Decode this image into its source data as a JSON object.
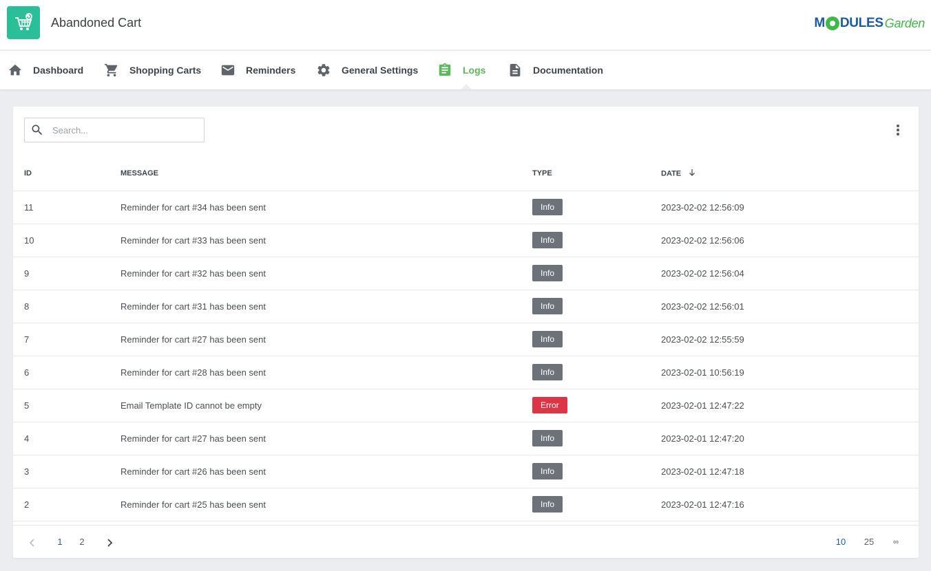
{
  "app": {
    "title": "Abandoned Cart",
    "icon": "shopping-cart-refresh-icon",
    "accent": "#2bbf99"
  },
  "brand": {
    "part1": "M",
    "part2": "DULES",
    "part3": "Garden",
    "colors": {
      "blue": "#1b5aa6",
      "green": "#41b94a"
    }
  },
  "nav": {
    "active_color": "#5cb85c",
    "items": [
      {
        "label": "Dashboard",
        "icon": "home-icon"
      },
      {
        "label": "Shopping Carts",
        "icon": "cart-icon"
      },
      {
        "label": "Reminders",
        "icon": "envelope-icon"
      },
      {
        "label": "General Settings",
        "icon": "gear-icon"
      },
      {
        "label": "Logs",
        "icon": "clipboard-icon",
        "active": true
      },
      {
        "label": "Documentation",
        "icon": "document-icon"
      }
    ]
  },
  "search": {
    "placeholder": "Search...",
    "value": ""
  },
  "table": {
    "columns": {
      "id": "ID",
      "message": "MESSAGE",
      "type": "TYPE",
      "date": "DATE"
    },
    "sorted_by": "date-desc",
    "rows": [
      {
        "id": "11",
        "message": "Reminder for cart #34 has been sent",
        "type": "Info",
        "date": "2023-02-02 12:56:09"
      },
      {
        "id": "10",
        "message": "Reminder for cart #33 has been sent",
        "type": "Info",
        "date": "2023-02-02 12:56:06"
      },
      {
        "id": "9",
        "message": "Reminder for cart #32 has been sent",
        "type": "Info",
        "date": "2023-02-02 12:56:04"
      },
      {
        "id": "8",
        "message": "Reminder for cart #31 has been sent",
        "type": "Info",
        "date": "2023-02-02 12:56:01"
      },
      {
        "id": "7",
        "message": "Reminder for cart #27 has been sent",
        "type": "Info",
        "date": "2023-02-02 12:55:59"
      },
      {
        "id": "6",
        "message": "Reminder for cart #28 has been sent",
        "type": "Info",
        "date": "2023-02-01 10:56:19"
      },
      {
        "id": "5",
        "message": "Email Template ID cannot be empty",
        "type": "Error",
        "date": "2023-02-01 12:47:22"
      },
      {
        "id": "4",
        "message": "Reminder for cart #27 has been sent",
        "type": "Info",
        "date": "2023-02-01 12:47:20"
      },
      {
        "id": "3",
        "message": "Reminder for cart #26 has been sent",
        "type": "Info",
        "date": "2023-02-01 12:47:18"
      },
      {
        "id": "2",
        "message": "Reminder for cart #25 has been sent",
        "type": "Info",
        "date": "2023-02-01 12:47:16"
      }
    ]
  },
  "pagination": {
    "pages": [
      "1",
      "2"
    ],
    "current_page": "1",
    "page_sizes": [
      "10",
      "25",
      "∞"
    ],
    "current_size": "10"
  },
  "colors": {
    "info_badge": "#6c727a",
    "error_badge": "#dc3545"
  }
}
